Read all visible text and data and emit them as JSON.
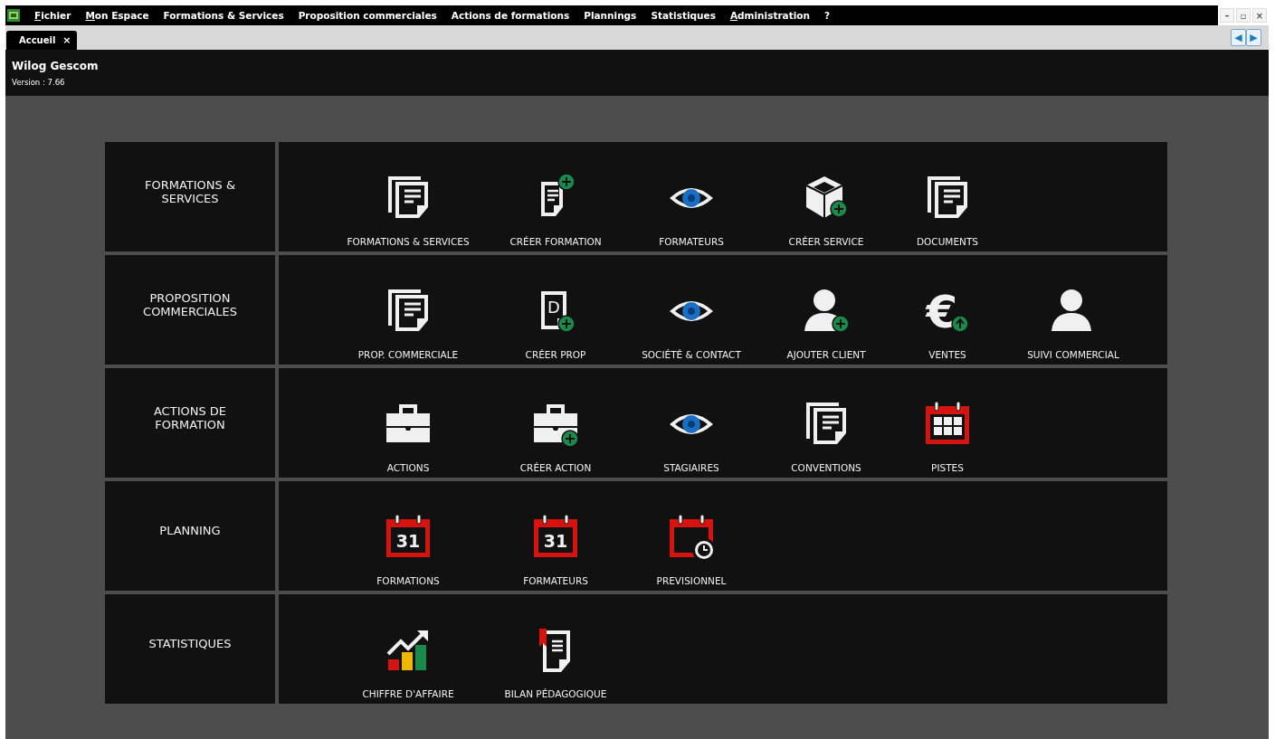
{
  "menu": [
    {
      "label": "Fichier",
      "underline_first": true
    },
    {
      "label": "Mon Espace",
      "underline_first": true
    },
    {
      "label": "Formations & Services",
      "underline_first": false
    },
    {
      "label": "Proposition commerciales",
      "underline_first": false
    },
    {
      "label": "Actions de formations",
      "underline_first": false
    },
    {
      "label": "Plannings",
      "underline_first": false
    },
    {
      "label": "Statistiques",
      "underline_first": false
    },
    {
      "label": "Administration",
      "underline_first": true
    },
    {
      "label": "?",
      "underline_first": false
    }
  ],
  "window_controls": [
    "–",
    "▫",
    "×"
  ],
  "tabs": [
    {
      "label": "Accueil",
      "close": "×",
      "selected": true
    }
  ],
  "tab_scroll": [
    "◀",
    "▶"
  ],
  "header": {
    "title": "Wilog Gescom",
    "version": "Version : 7.66"
  },
  "sections": [
    {
      "title": "FORMATIONS & SERVICES",
      "tiles": [
        {
          "label": "FORMATIONS & SERVICES",
          "kind": "docs"
        },
        {
          "label": "CRÉER FORMATION",
          "kind": "doc-add"
        },
        {
          "label": "FORMATEURS",
          "kind": "eye"
        },
        {
          "label": "CRÉER SERVICE",
          "kind": "box-add"
        },
        {
          "label": "DOCUMENTS",
          "kind": "docs"
        }
      ]
    },
    {
      "title": "PROPOSITION COMMERCIALES",
      "tiles": [
        {
          "label": "PROP. COMMERCIALE",
          "kind": "docs"
        },
        {
          "label": "CRÉER PROP",
          "kind": "doc-letter-add",
          "icon_text": "D"
        },
        {
          "label": "SOCIÉTÉ & CONTACT",
          "kind": "eye"
        },
        {
          "label": "AJOUTER CLIENT",
          "kind": "user-add"
        },
        {
          "label": "VENTES",
          "kind": "euro-up",
          "icon_text": "€"
        },
        {
          "label": "SUIVI COMMERCIAL",
          "kind": "user"
        }
      ]
    },
    {
      "title": "ACTIONS DE FORMATION",
      "tiles": [
        {
          "label": "ACTIONS",
          "kind": "briefcase"
        },
        {
          "label": "CRÉER ACTION",
          "kind": "briefcase-add"
        },
        {
          "label": "STAGIAIRES",
          "kind": "eye"
        },
        {
          "label": "CONVENTIONS",
          "kind": "docs"
        },
        {
          "label": "PISTES",
          "kind": "calendar-grid"
        }
      ]
    },
    {
      "title": "PLANNING",
      "tiles": [
        {
          "label": "FORMATIONS",
          "kind": "calendar-day",
          "icon_text": "31"
        },
        {
          "label": "FORMATEURS",
          "kind": "calendar-day",
          "icon_text": "31"
        },
        {
          "label": "PREVISIONNEL",
          "kind": "calendar-clock"
        }
      ]
    },
    {
      "title": "STATISTIQUES",
      "tiles": [
        {
          "label": "CHIFFRE D'AFFAIRE",
          "kind": "chart"
        },
        {
          "label": "BILAN PÉDAGOGIQUE",
          "kind": "doc-bookmark"
        }
      ]
    }
  ]
}
